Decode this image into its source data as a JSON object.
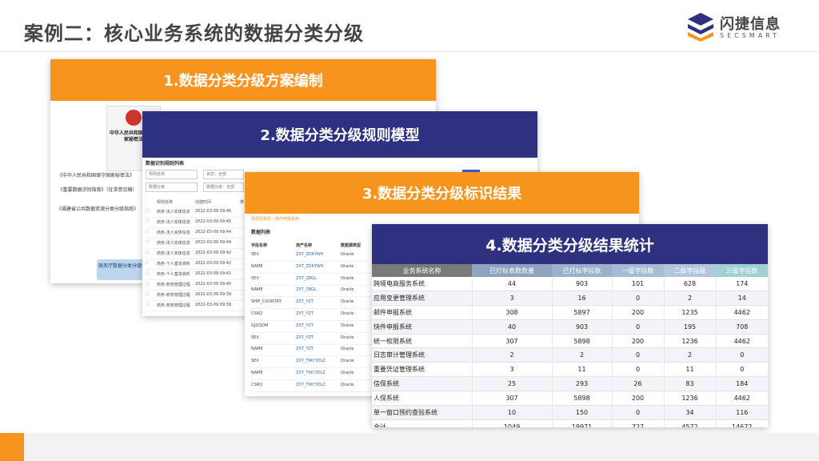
{
  "slide": {
    "title": "案例二：核心业务系统的数据分类分级",
    "logo_text": "闪捷信息",
    "logo_sub": "SECSMART"
  },
  "card1": {
    "banner": "1.数据分类分级方案编制",
    "doc_title": "中华人民共和国保守国家秘密法",
    "texts": [
      "《中华人民共和国保守国家秘密法》",
      "《重要数据识别指南》（征求意见稿）",
      "《福建省公共数据资源分类分级指南》"
    ],
    "button": "商务厅数据分类分级需求"
  },
  "card2": {
    "banner": "2.数据分类分级规则模型",
    "list_title": "数据识别规则列表",
    "search_placeholder": "规则名称",
    "filter1": "状态：全部",
    "filter2": "数据分级",
    "filter3": "数据分级：全部",
    "columns": [
      "规则名称",
      "创建时间",
      "类"
    ],
    "rows": [
      {
        "name": "商务-法人实体信息",
        "time": "2022-03-09 09:46"
      },
      {
        "name": "商务-法人实体信息",
        "time": "2022-03-09 09:45"
      },
      {
        "name": "商务-法人实体信息",
        "time": "2022-03-09 09:44"
      },
      {
        "name": "商务-法人实体信息",
        "time": "2022-03-09 09:44"
      },
      {
        "name": "商务-法人实体信息",
        "time": "2022-03-09 09:42"
      },
      {
        "name": "商务-个人基本资料",
        "time": "2022-03-09 09:42"
      },
      {
        "name": "商务-个人基本资料",
        "time": "2022-03-09 09:41"
      },
      {
        "name": "商务-商务管理过程",
        "time": "2022-03-09 09:40"
      },
      {
        "name": "商务-商务管理过程",
        "time": "2022-03-09 09:39"
      },
      {
        "name": "商务-商务管理过程",
        "time": "2022-03-09 09:39"
      }
    ]
  },
  "card3": {
    "banner": "3.数据分类分级标识结果",
    "tab": "数据源系统 / 邮件申报系统",
    "subtitle": "数据列表",
    "columns": [
      "字段名称",
      "资产名称",
      "数据源类型"
    ],
    "rows": [
      {
        "field": "SEX",
        "asset": "ZXT_ZDKYWH",
        "type": "Oracle"
      },
      {
        "field": "NAME",
        "asset": "ZXT_ZDKYWH",
        "type": "Oracle"
      },
      {
        "field": "SEX",
        "asset": "ZXT_ZBGL",
        "type": "Oracle"
      },
      {
        "field": "NAME",
        "asset": "ZXT_ZBGL",
        "type": "Oracle"
      },
      {
        "field": "SHIP_COUNTRY",
        "asset": "ZXT_YZT",
        "type": "Oracle"
      },
      {
        "field": "CSRQ",
        "asset": "ZXT_YZT",
        "type": "Oracle"
      },
      {
        "field": "GJDQDM",
        "asset": "ZXT_YZT",
        "type": "Oracle"
      },
      {
        "field": "SEX",
        "asset": "ZXT_YZT",
        "type": "Oracle"
      },
      {
        "field": "NAME",
        "asset": "ZXT_YZT",
        "type": "Oracle"
      },
      {
        "field": "SEX",
        "asset": "ZXT_TWCYDLZ",
        "type": "Oracle"
      },
      {
        "field": "NAME",
        "asset": "ZXT_TWCYDLZ",
        "type": "Oracle"
      },
      {
        "field": "CSRQ",
        "asset": "ZXT_TWCYDLZ",
        "type": "Oracle"
      }
    ]
  },
  "card4": {
    "banner": "4.数据分类分级结果统计",
    "columns": [
      "业务系统名称",
      "已打标表数数量",
      "已打标字段数",
      "一级字段数",
      "二级字段级",
      "三级字段数"
    ],
    "rows": [
      [
        "跨境电商服务系统",
        "44",
        "903",
        "101",
        "628",
        "174"
      ],
      [
        "应用变更管理系统",
        "3",
        "16",
        "0",
        "2",
        "14"
      ],
      [
        "邮件申报系统",
        "308",
        "5897",
        "200",
        "1235",
        "4462"
      ],
      [
        "快件申报系统",
        "40",
        "903",
        "0",
        "195",
        "708"
      ],
      [
        "统一权限系统",
        "307",
        "5898",
        "200",
        "1236",
        "4462"
      ],
      [
        "日志审计管理系统",
        "2",
        "2",
        "0",
        "2",
        "0"
      ],
      [
        "重要凭证管理系统",
        "3",
        "11",
        "0",
        "11",
        "0"
      ],
      [
        "信保系统",
        "25",
        "293",
        "26",
        "83",
        "184"
      ],
      [
        "人保系统",
        "307",
        "5898",
        "200",
        "1236",
        "4462"
      ],
      [
        "单一窗口预约查验系统",
        "10",
        "150",
        "0",
        "34",
        "116"
      ],
      [
        "合计",
        "1049",
        "19971",
        "727",
        "4572",
        "14672"
      ]
    ]
  },
  "colors": {
    "accent": "#f7941d",
    "navy": "#2e3180"
  },
  "icons": [
    "secsmart-logo-icon",
    "search-icon",
    "national-emblem-icon"
  ]
}
